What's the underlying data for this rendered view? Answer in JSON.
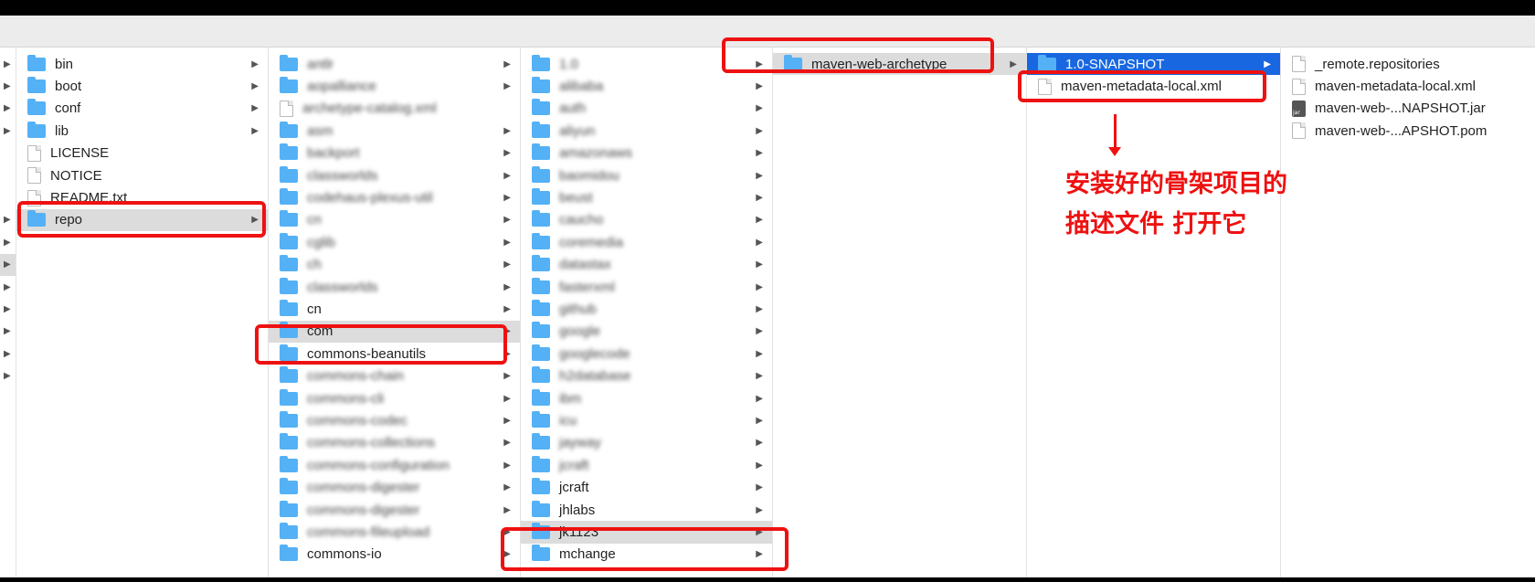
{
  "columns": [
    {
      "items": [
        {
          "name": "bin",
          "kind": "folder",
          "arrow": true
        },
        {
          "name": "boot",
          "kind": "folder",
          "arrow": true
        },
        {
          "name": "conf",
          "kind": "folder",
          "arrow": true
        },
        {
          "name": "lib",
          "kind": "folder",
          "arrow": true
        },
        {
          "name": "LICENSE",
          "kind": "file",
          "arrow": false
        },
        {
          "name": "NOTICE",
          "kind": "file",
          "arrow": false
        },
        {
          "name": "README.txt",
          "kind": "file",
          "arrow": false
        },
        {
          "name": "repo",
          "kind": "folder",
          "arrow": true,
          "selected": "grey"
        }
      ]
    },
    {
      "items": [
        {
          "name": "antlr",
          "kind": "folder",
          "arrow": true,
          "blurred": true
        },
        {
          "name": "aopalliance",
          "kind": "folder",
          "arrow": true,
          "blurred": true
        },
        {
          "name": "archetype-catalog.xml",
          "kind": "file",
          "arrow": false,
          "blurred": true
        },
        {
          "name": "asm",
          "kind": "folder",
          "arrow": true,
          "blurred": true
        },
        {
          "name": "backport",
          "kind": "folder",
          "arrow": true,
          "blurred": true
        },
        {
          "name": "classworlds",
          "kind": "folder",
          "arrow": true,
          "blurred": true
        },
        {
          "name": "codehaus-plexus-util",
          "kind": "folder",
          "arrow": true,
          "blurred": true
        },
        {
          "name": "cn",
          "kind": "folder",
          "arrow": true,
          "blurred": true
        },
        {
          "name": "cglib",
          "kind": "folder",
          "arrow": true,
          "blurred": true
        },
        {
          "name": "ch",
          "kind": "folder",
          "arrow": true,
          "blurred": true
        },
        {
          "name": "classworlds",
          "kind": "folder",
          "arrow": true,
          "blurred": true
        },
        {
          "name": "cn",
          "kind": "folder",
          "arrow": true
        },
        {
          "name": "com",
          "kind": "folder",
          "arrow": true,
          "selected": "grey"
        },
        {
          "name": "commons-beanutils",
          "kind": "folder",
          "arrow": true
        },
        {
          "name": "commons-chain",
          "kind": "folder",
          "arrow": true,
          "blurred": true
        },
        {
          "name": "commons-cli",
          "kind": "folder",
          "arrow": true,
          "blurred": true
        },
        {
          "name": "commons-codec",
          "kind": "folder",
          "arrow": true,
          "blurred": true
        },
        {
          "name": "commons-collections",
          "kind": "folder",
          "arrow": true,
          "blurred": true
        },
        {
          "name": "commons-configuration",
          "kind": "folder",
          "arrow": true,
          "blurred": true
        },
        {
          "name": "commons-digester",
          "kind": "folder",
          "arrow": true,
          "blurred": true
        },
        {
          "name": "commons-digester",
          "kind": "folder",
          "arrow": true,
          "blurred": true
        },
        {
          "name": "commons-fileupload",
          "kind": "folder",
          "arrow": true,
          "blurred": true
        },
        {
          "name": "commons-io",
          "kind": "folder",
          "arrow": true
        }
      ]
    },
    {
      "items": [
        {
          "name": "1.0",
          "kind": "folder",
          "arrow": true,
          "blurred": true
        },
        {
          "name": "alibaba",
          "kind": "folder",
          "arrow": true,
          "blurred": true
        },
        {
          "name": "auth",
          "kind": "folder",
          "arrow": true,
          "blurred": true
        },
        {
          "name": "aliyun",
          "kind": "folder",
          "arrow": true,
          "blurred": true
        },
        {
          "name": "amazonaws",
          "kind": "folder",
          "arrow": true,
          "blurred": true
        },
        {
          "name": "baomidou",
          "kind": "folder",
          "arrow": true,
          "blurred": true
        },
        {
          "name": "beust",
          "kind": "folder",
          "arrow": true,
          "blurred": true
        },
        {
          "name": "caucho",
          "kind": "folder",
          "arrow": true,
          "blurred": true
        },
        {
          "name": "coremedia",
          "kind": "folder",
          "arrow": true,
          "blurred": true
        },
        {
          "name": "datastax",
          "kind": "folder",
          "arrow": true,
          "blurred": true
        },
        {
          "name": "fasterxml",
          "kind": "folder",
          "arrow": true,
          "blurred": true
        },
        {
          "name": "github",
          "kind": "folder",
          "arrow": true,
          "blurred": true
        },
        {
          "name": "google",
          "kind": "folder",
          "arrow": true,
          "blurred": true
        },
        {
          "name": "googlecode",
          "kind": "folder",
          "arrow": true,
          "blurred": true
        },
        {
          "name": "h2database",
          "kind": "folder",
          "arrow": true,
          "blurred": true
        },
        {
          "name": "ibm",
          "kind": "folder",
          "arrow": true,
          "blurred": true
        },
        {
          "name": "icu",
          "kind": "folder",
          "arrow": true,
          "blurred": true
        },
        {
          "name": "jayway",
          "kind": "folder",
          "arrow": true,
          "blurred": true
        },
        {
          "name": "jcraft",
          "kind": "folder",
          "arrow": true,
          "blurred": true
        },
        {
          "name": "jcraft",
          "kind": "folder",
          "arrow": true
        },
        {
          "name": "jhlabs",
          "kind": "folder",
          "arrow": true
        },
        {
          "name": "jk1123",
          "kind": "folder",
          "arrow": true,
          "selected": "grey"
        },
        {
          "name": "mchange",
          "kind": "folder",
          "arrow": true
        }
      ]
    },
    {
      "items": [
        {
          "name": "maven-web-archetype",
          "kind": "folder",
          "arrow": true,
          "selected": "grey"
        }
      ]
    },
    {
      "items": [
        {
          "name": "1.0-SNAPSHOT",
          "kind": "folder",
          "arrow": true,
          "selected": "blue"
        },
        {
          "name": "maven-metadata-local.xml",
          "kind": "file",
          "arrow": false
        }
      ]
    },
    {
      "items": [
        {
          "name": "_remote.repositories",
          "kind": "file",
          "arrow": false
        },
        {
          "name": "maven-metadata-local.xml",
          "kind": "file",
          "arrow": false
        },
        {
          "name": "maven-web-...NAPSHOT.jar",
          "kind": "jar",
          "arrow": false
        },
        {
          "name": "maven-web-...APSHOT.pom",
          "kind": "file",
          "arrow": false
        }
      ]
    }
  ],
  "annotation": {
    "line1": "安装好的骨架项目的",
    "line2": "描述文件 打开它",
    "color": "#ee1111"
  },
  "colors": {
    "folder": "#54b1f6",
    "selection_blue": "#1867e0",
    "selection_grey": "#dcdcdc"
  }
}
